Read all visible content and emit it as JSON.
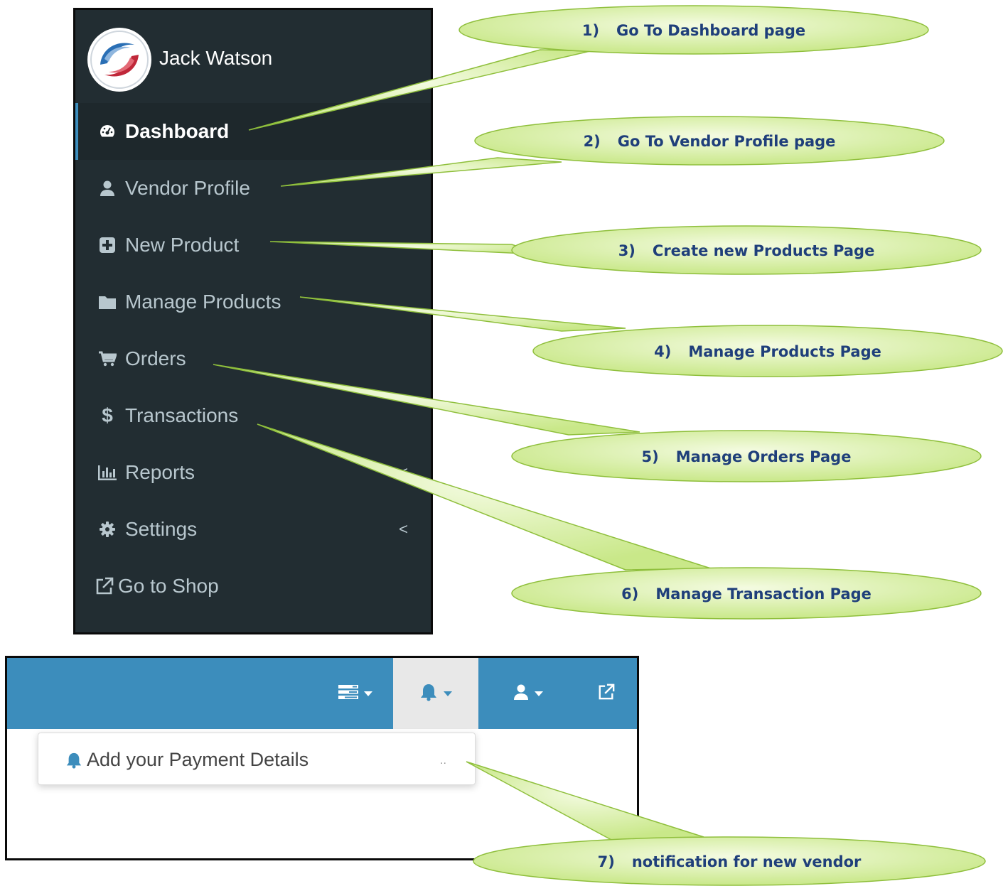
{
  "sidebar": {
    "user_name": "Jack Watson",
    "menu": [
      {
        "label": "Dashboard",
        "icon": "dashboard-icon",
        "active": true
      },
      {
        "label": "Vendor Profile",
        "icon": "user-icon"
      },
      {
        "label": "New Product",
        "icon": "plus-square-icon"
      },
      {
        "label": "Manage Products",
        "icon": "folder-icon"
      },
      {
        "label": "Orders",
        "icon": "cart-icon"
      },
      {
        "label": "Transactions",
        "icon": "dollar-icon",
        "glyph": "$"
      },
      {
        "label": "Reports",
        "icon": "bar-chart-icon",
        "chevron": "<"
      },
      {
        "label": "Settings",
        "icon": "cog-icon",
        "chevron": "<"
      },
      {
        "label": "Go to Shop",
        "icon": "external-link-icon"
      }
    ]
  },
  "navbar": {
    "notification_dropdown": {
      "item": "Add your Payment Details",
      "dots": ".."
    }
  },
  "callouts": [
    {
      "num": "1)",
      "text": "Go To Dashboard page"
    },
    {
      "num": "2)",
      "text": "Go To Vendor Profile  page"
    },
    {
      "num": "3)",
      "text": "Create new Products Page"
    },
    {
      "num": "4)",
      "text": "Manage Products Page"
    },
    {
      "num": "5)",
      "text": "Manage Orders Page"
    },
    {
      "num": "6)",
      "text": "Manage Transaction Page"
    },
    {
      "num": "7)",
      "text": "notification for new vendor"
    }
  ],
  "colors": {
    "sidebar_bg": "#222d32",
    "navbar_bg": "#3c8dbc",
    "callout_fill": "#d6ef9c",
    "callout_text": "#1f3f7a"
  }
}
